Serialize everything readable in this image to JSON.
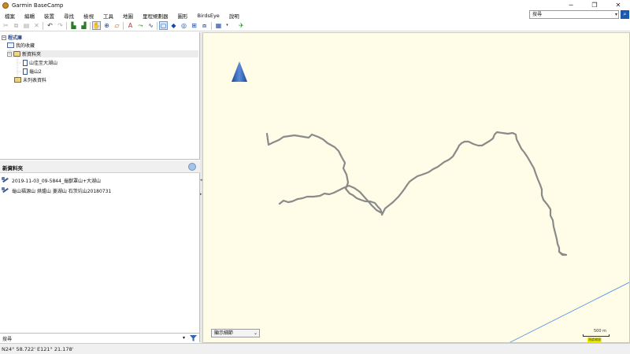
{
  "window": {
    "title": "Garmin BaseCamp",
    "controls": [
      "─",
      "❐",
      "✕"
    ]
  },
  "menu": [
    "檔案",
    "編輯",
    "裝置",
    "尋找",
    "檢視",
    "工具",
    "地圖",
    "里程規劃器",
    "圖形",
    "BirdsEye",
    "說明"
  ],
  "search": {
    "value": "搜尋",
    "dropdown": "▾",
    "button": "⌕"
  },
  "library": {
    "header": "程式庫",
    "minus": "−",
    "items": [
      {
        "label": "我的收藏"
      },
      {
        "label": "新資料夾",
        "expander": "−"
      },
      {
        "label": "山佳至大湖山"
      },
      {
        "label": "龜山2"
      },
      {
        "label": "未列表資料"
      }
    ]
  },
  "list_panel": {
    "header": "新資料夾",
    "rows": [
      {
        "label": "2019-11-03_09-5844_龜獸罩山+大湖山"
      },
      {
        "label": "龜山福源山 烘爐山 菱湖山 石茨坑山20180731"
      }
    ]
  },
  "filter": {
    "placeholder": "搜尋",
    "dropdown": "▾"
  },
  "status": {
    "coordinates": "N24° 58.722' E121° 21.178'"
  },
  "splitter": {
    "left_arrow": "◂",
    "right_arrow": "▸"
  },
  "map": {
    "display_select": "顯示細節",
    "select_arrow": "⌄",
    "scale_label": "500 m",
    "scale_unit": "過度縮放",
    "track_color": "#8a8a8a",
    "compass_color": "#2f63b8",
    "background_color": "#fffde8",
    "boundary_line_color": "#4a90e2"
  }
}
